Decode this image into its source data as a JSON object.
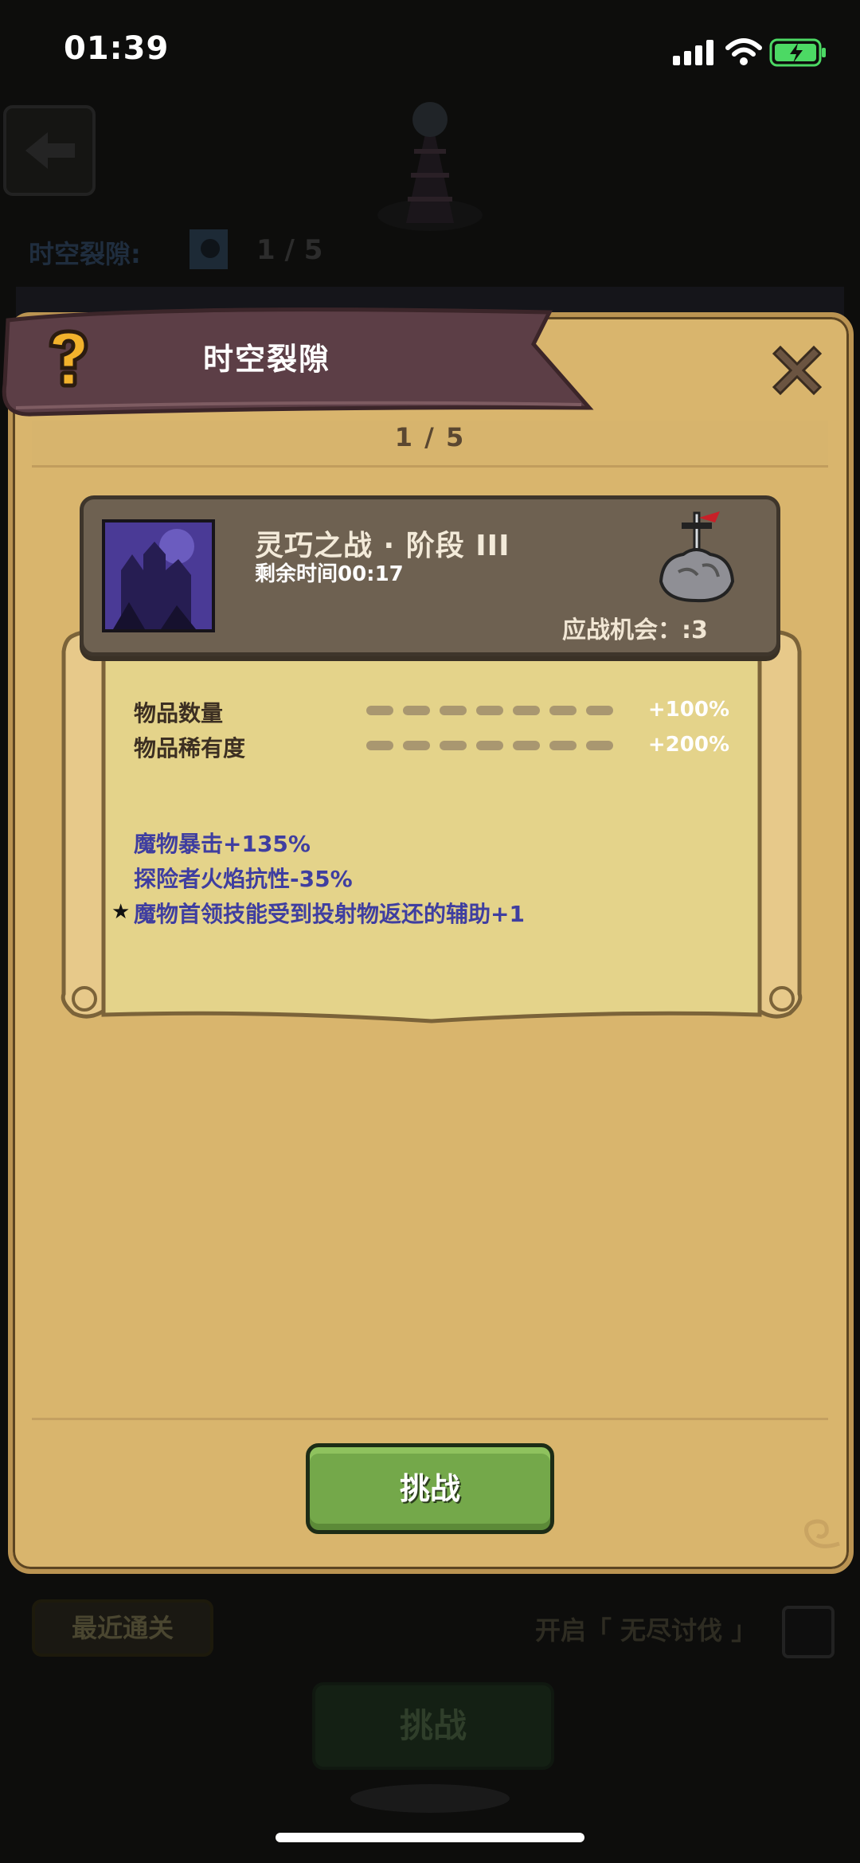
{
  "status_bar": {
    "time": "01:39"
  },
  "background": {
    "rift_label": "时空裂隙:",
    "rift_count": "1 / 5",
    "recent_clear": "最近通关",
    "endless_label": "开启「 无尽讨伐 」",
    "challenge": "挑战"
  },
  "modal": {
    "title": "时空裂隙",
    "counter": "1 / 5",
    "stage": {
      "name": "灵巧之战 · 阶段 III",
      "time_remaining": "剩余时间00:17",
      "chances": "应战机会：:3"
    },
    "stats": [
      {
        "label": "物品数量",
        "value": "+100%"
      },
      {
        "label": "物品稀有度",
        "value": "+200%"
      }
    ],
    "modifiers": [
      "魔物暴击+135%",
      "探险者火焰抗性-35%",
      "魔物首领技能受到投射物返还的辅助+1"
    ],
    "challenge_button": "挑战"
  },
  "colors": {
    "parchment": "#d9b56d",
    "banner": "#5c3e46",
    "button_green": "#74a84a",
    "modifier_text": "#3f3ea0"
  },
  "icons": [
    "signal-icon",
    "wifi-icon",
    "battery-icon",
    "help-icon",
    "close-icon",
    "sword-icon",
    "star-icon"
  ]
}
